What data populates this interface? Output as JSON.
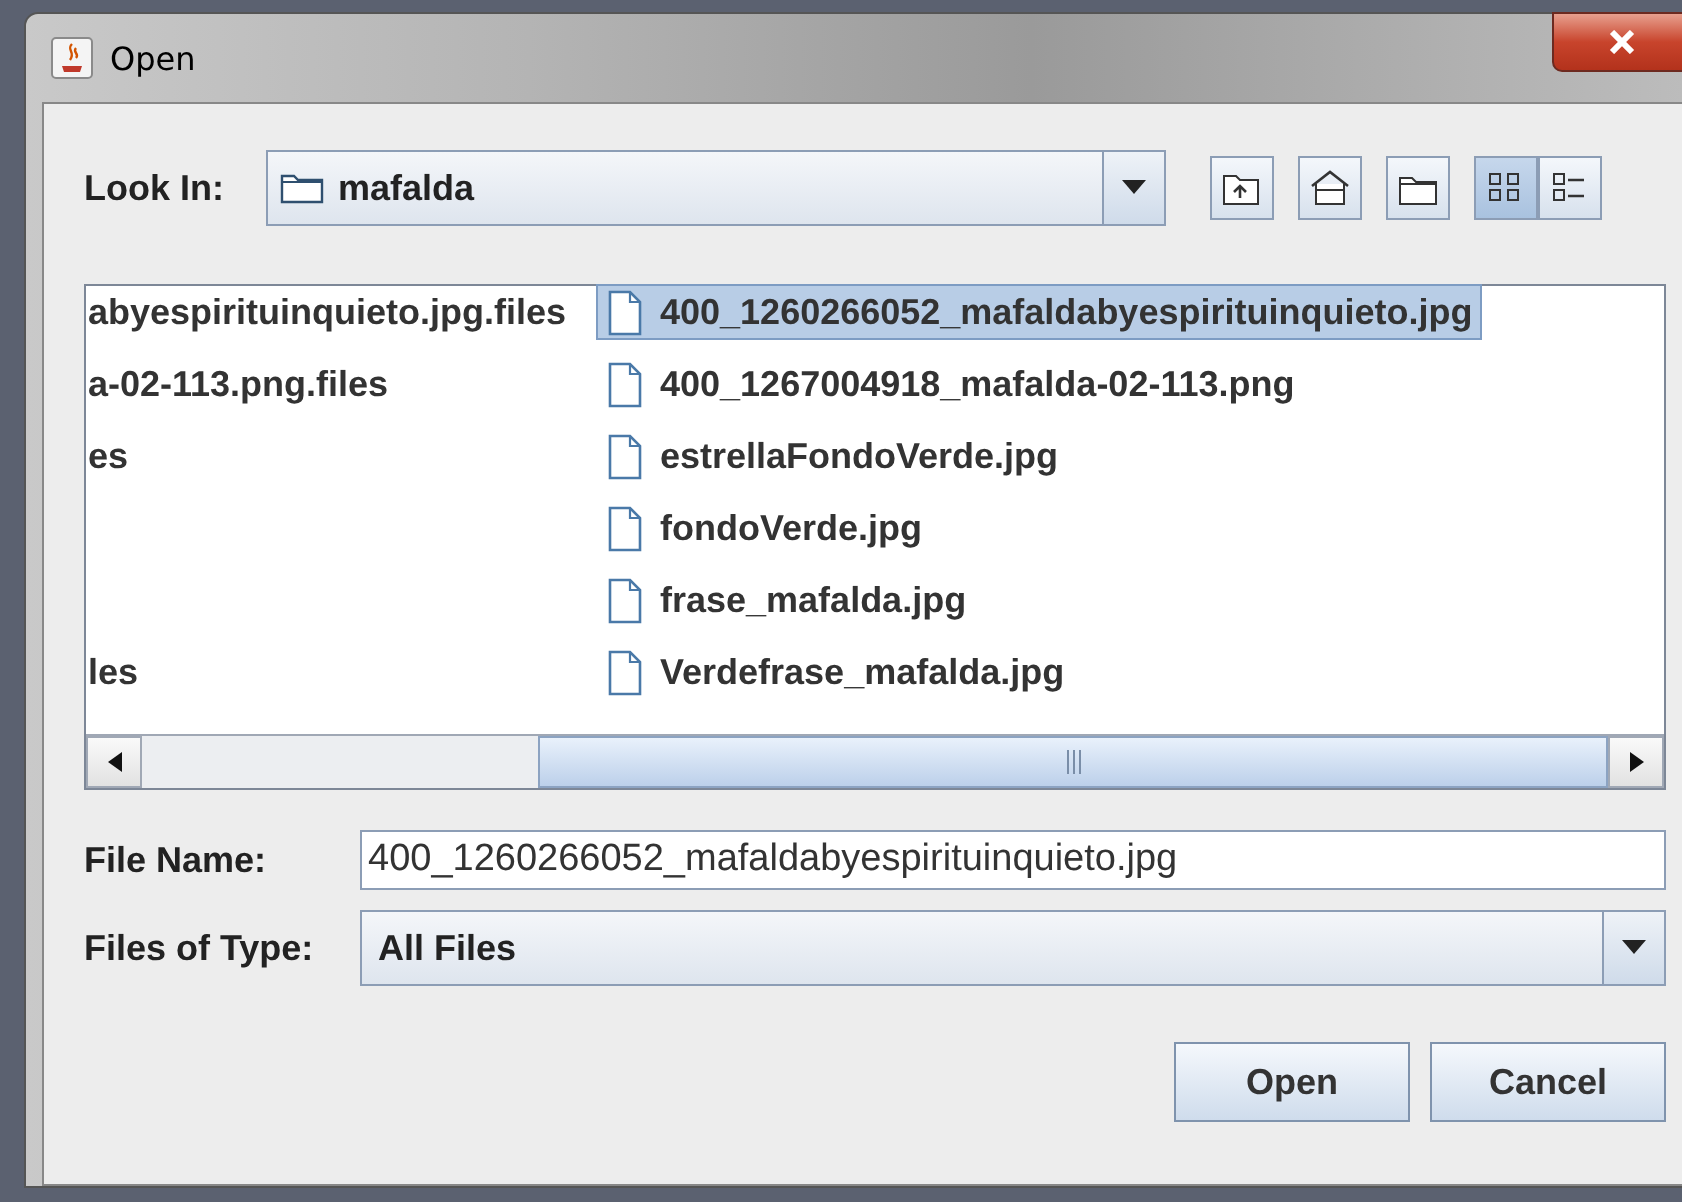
{
  "window": {
    "title": "Open"
  },
  "look_in": {
    "label": "Look In:",
    "value": "mafalda"
  },
  "toolbar": [
    {
      "kind": "up-folder",
      "selected": false
    },
    {
      "kind": "home",
      "selected": false
    },
    {
      "kind": "new-folder",
      "selected": false
    },
    {
      "kind": "list-view",
      "selected": true
    },
    {
      "kind": "details-view",
      "selected": false
    }
  ],
  "file_list": {
    "columns": [
      {
        "items": [
          {
            "name": "abyespirituinquieto.jpg.files",
            "selected": false
          },
          {
            "name": "a-02-113.png.files",
            "selected": false
          },
          {
            "name": "es",
            "selected": false
          },
          {
            "selected": false
          },
          {
            "selected": false
          },
          {
            "name": "les",
            "selected": false
          }
        ]
      },
      {
        "items": [
          {
            "kind": "file",
            "name": "400_1260266052_mafaldabyespirituinquieto.jpg",
            "selected": true
          },
          {
            "kind": "file",
            "name": "400_1267004918_mafalda-02-113.png",
            "selected": false
          },
          {
            "kind": "file",
            "name": "estrellaFondoVerde.jpg",
            "selected": false
          },
          {
            "kind": "file",
            "name": "fondoVerde.jpg",
            "selected": false
          },
          {
            "kind": "file",
            "name": "frase_mafalda.jpg",
            "selected": false
          },
          {
            "kind": "file",
            "name": "Verdefrase_mafalda.jpg",
            "selected": false
          }
        ]
      }
    ]
  },
  "file_name": {
    "label": "File Name:",
    "value": "400_1260266052_mafaldabyespirituinquieto.jpg"
  },
  "files_of_type": {
    "label": "Files of Type:",
    "value": "All Files"
  },
  "buttons": [
    "Open",
    "Cancel"
  ]
}
